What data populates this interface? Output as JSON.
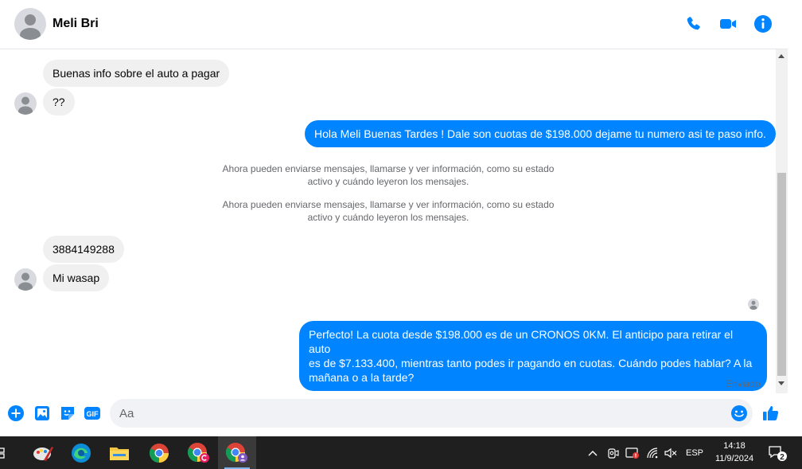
{
  "header": {
    "contact_name": "Meli Bri",
    "icons": [
      "phone-icon",
      "video-camera-icon",
      "info-icon"
    ],
    "accent_color": "#0084ff"
  },
  "messages": {
    "in_1": "Buenas info sobre el auto a pagar",
    "in_2": "??",
    "out_1": "Hola Meli Buenas Tardes ! Dale son cuotas de $198.000 dejame tu numero asi te paso info.",
    "system_1_line1": "Ahora pueden enviarse mensajes, llamarse y ver información, como su estado",
    "system_1_line2": "activo y cuándo leyeron los mensajes.",
    "system_2_line1": "Ahora pueden enviarse mensajes, llamarse y ver información, como su estado",
    "system_2_line2": "activo y cuándo leyeron los mensajes.",
    "in_3": "3884149288",
    "in_4": "Mi wasap",
    "out_2_line1": "Perfecto! La cuota desde $198.000 es de un CRONOS 0KM. El anticipo para retirar el auto",
    "out_2_line2": "es de $7.133.400, mientras tanto podes ir pagando en cuotas. Cuándo podes hablar? A la",
    "out_2_line3": "mañana o a la tarde?",
    "status": "Enviado"
  },
  "composer": {
    "placeholder": "Aa",
    "gif_label": "GIF",
    "icons": [
      "plus-icon",
      "image-icon",
      "sticker-icon",
      "gif-icon",
      "emoji-icon",
      "thumbs-up-icon"
    ]
  },
  "taskbar": {
    "apps": [
      "task-view-icon",
      "paint-icon",
      "edge-icon",
      "file-explorer-icon",
      "chrome-icon",
      "chrome-profile-c-icon",
      "chrome-profile-2-icon"
    ],
    "lang": "ESP",
    "time": "14:18",
    "date": "11/9/2024",
    "notifications": "2"
  }
}
